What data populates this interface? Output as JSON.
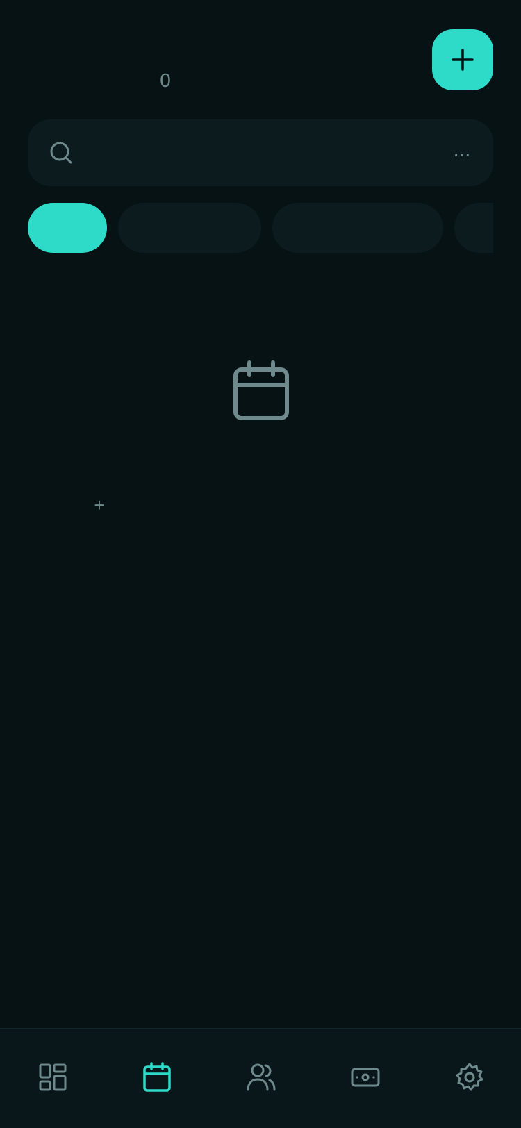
{
  "header": {
    "count": "0"
  },
  "search": {
    "placeholder": "",
    "more_label": "..."
  },
  "filters": [
    {
      "label": "",
      "active": true
    },
    {
      "label": "",
      "active": false
    },
    {
      "label": "",
      "active": false
    },
    {
      "label": "",
      "active": false
    }
  ],
  "empty_state": {
    "icon": "calendar-icon",
    "add_label": "+"
  },
  "nav": {
    "items": [
      {
        "icon": "dashboard-icon",
        "active": false
      },
      {
        "icon": "calendar-icon",
        "active": true
      },
      {
        "icon": "users-icon",
        "active": false
      },
      {
        "icon": "money-icon",
        "active": false
      },
      {
        "icon": "gear-icon",
        "active": false
      }
    ]
  },
  "colors": {
    "background": "#061214",
    "surface": "#0c1b1e",
    "accent": "#2ddbc8",
    "muted": "#6f8a8c"
  }
}
